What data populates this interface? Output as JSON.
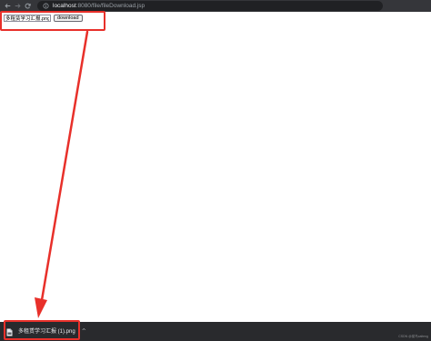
{
  "browser": {
    "url_host": "localhost",
    "url_path": ":8080/file/fileDownload.jsp"
  },
  "form": {
    "filename_value": "多租赁学习汇报.png",
    "download_label": "download"
  },
  "download_shelf": {
    "file_name": "多租赁学习汇报 (1).png",
    "menu_glyph": "^"
  },
  "watermark": "CSDN @菜鸟caiteng",
  "colors": {
    "highlight": "#e8302a",
    "toolbar": "#35363a",
    "shelf": "#292a2d"
  }
}
